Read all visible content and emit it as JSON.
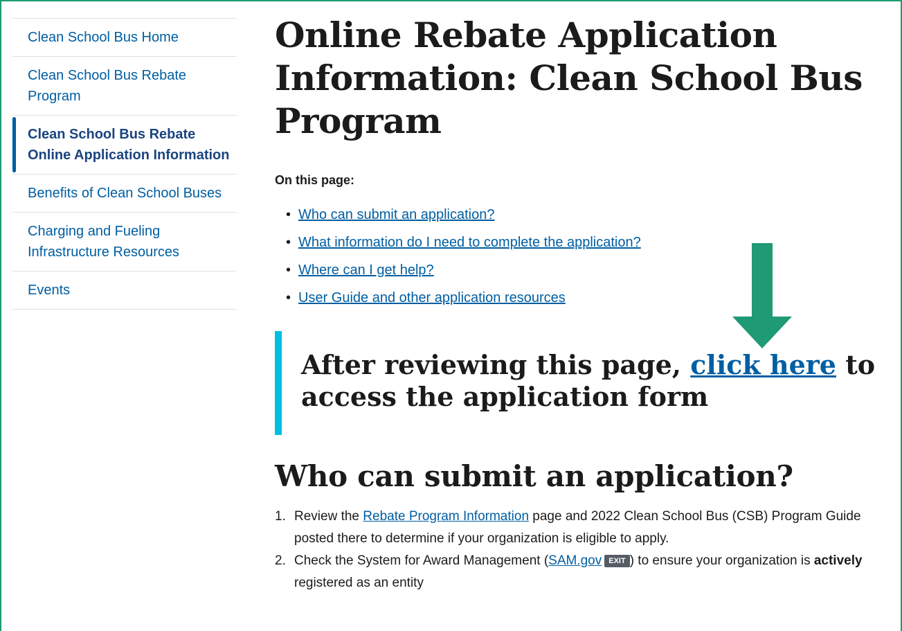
{
  "sidebar": {
    "items": [
      {
        "label": "Clean School Bus Home"
      },
      {
        "label": "Clean School Bus Rebate Program"
      },
      {
        "label": "Clean School Bus Rebate Online Application Information"
      },
      {
        "label": "Benefits of Clean School Buses"
      },
      {
        "label": "Charging and Fueling Infrastructure Resources"
      },
      {
        "label": "Events"
      }
    ]
  },
  "main": {
    "title": "Online Rebate Application Information: Clean School Bus Program",
    "on_this_page": "On this page:",
    "toc": [
      "Who can submit an application?",
      "What information do I need to complete the application?",
      "Where can I get help?",
      "User Guide and other application resources"
    ],
    "callout": {
      "before": "After reviewing this page, ",
      "link": "click here",
      "after": " to access the application form"
    },
    "section_title": "Who can submit an application?",
    "steps": {
      "s1": {
        "num": "1.",
        "before": "Review the ",
        "link": "Rebate Program Information",
        "after": " page and 2022 Clean School Bus (CSB) Program Guide posted there to determine if your organization is eligible to apply."
      },
      "s2": {
        "num": "2.",
        "before": "Check the System for Award Management (",
        "link": "SAM.gov",
        "badge": "EXIT",
        "after": ") to ensure your organization is ",
        "bold": "actively",
        "end": " registered as an entity"
      }
    }
  },
  "colors": {
    "frame": "#1e9a74",
    "arrow": "#1e9a74",
    "link": "#005ea2",
    "callout_bar": "#00bde3"
  }
}
